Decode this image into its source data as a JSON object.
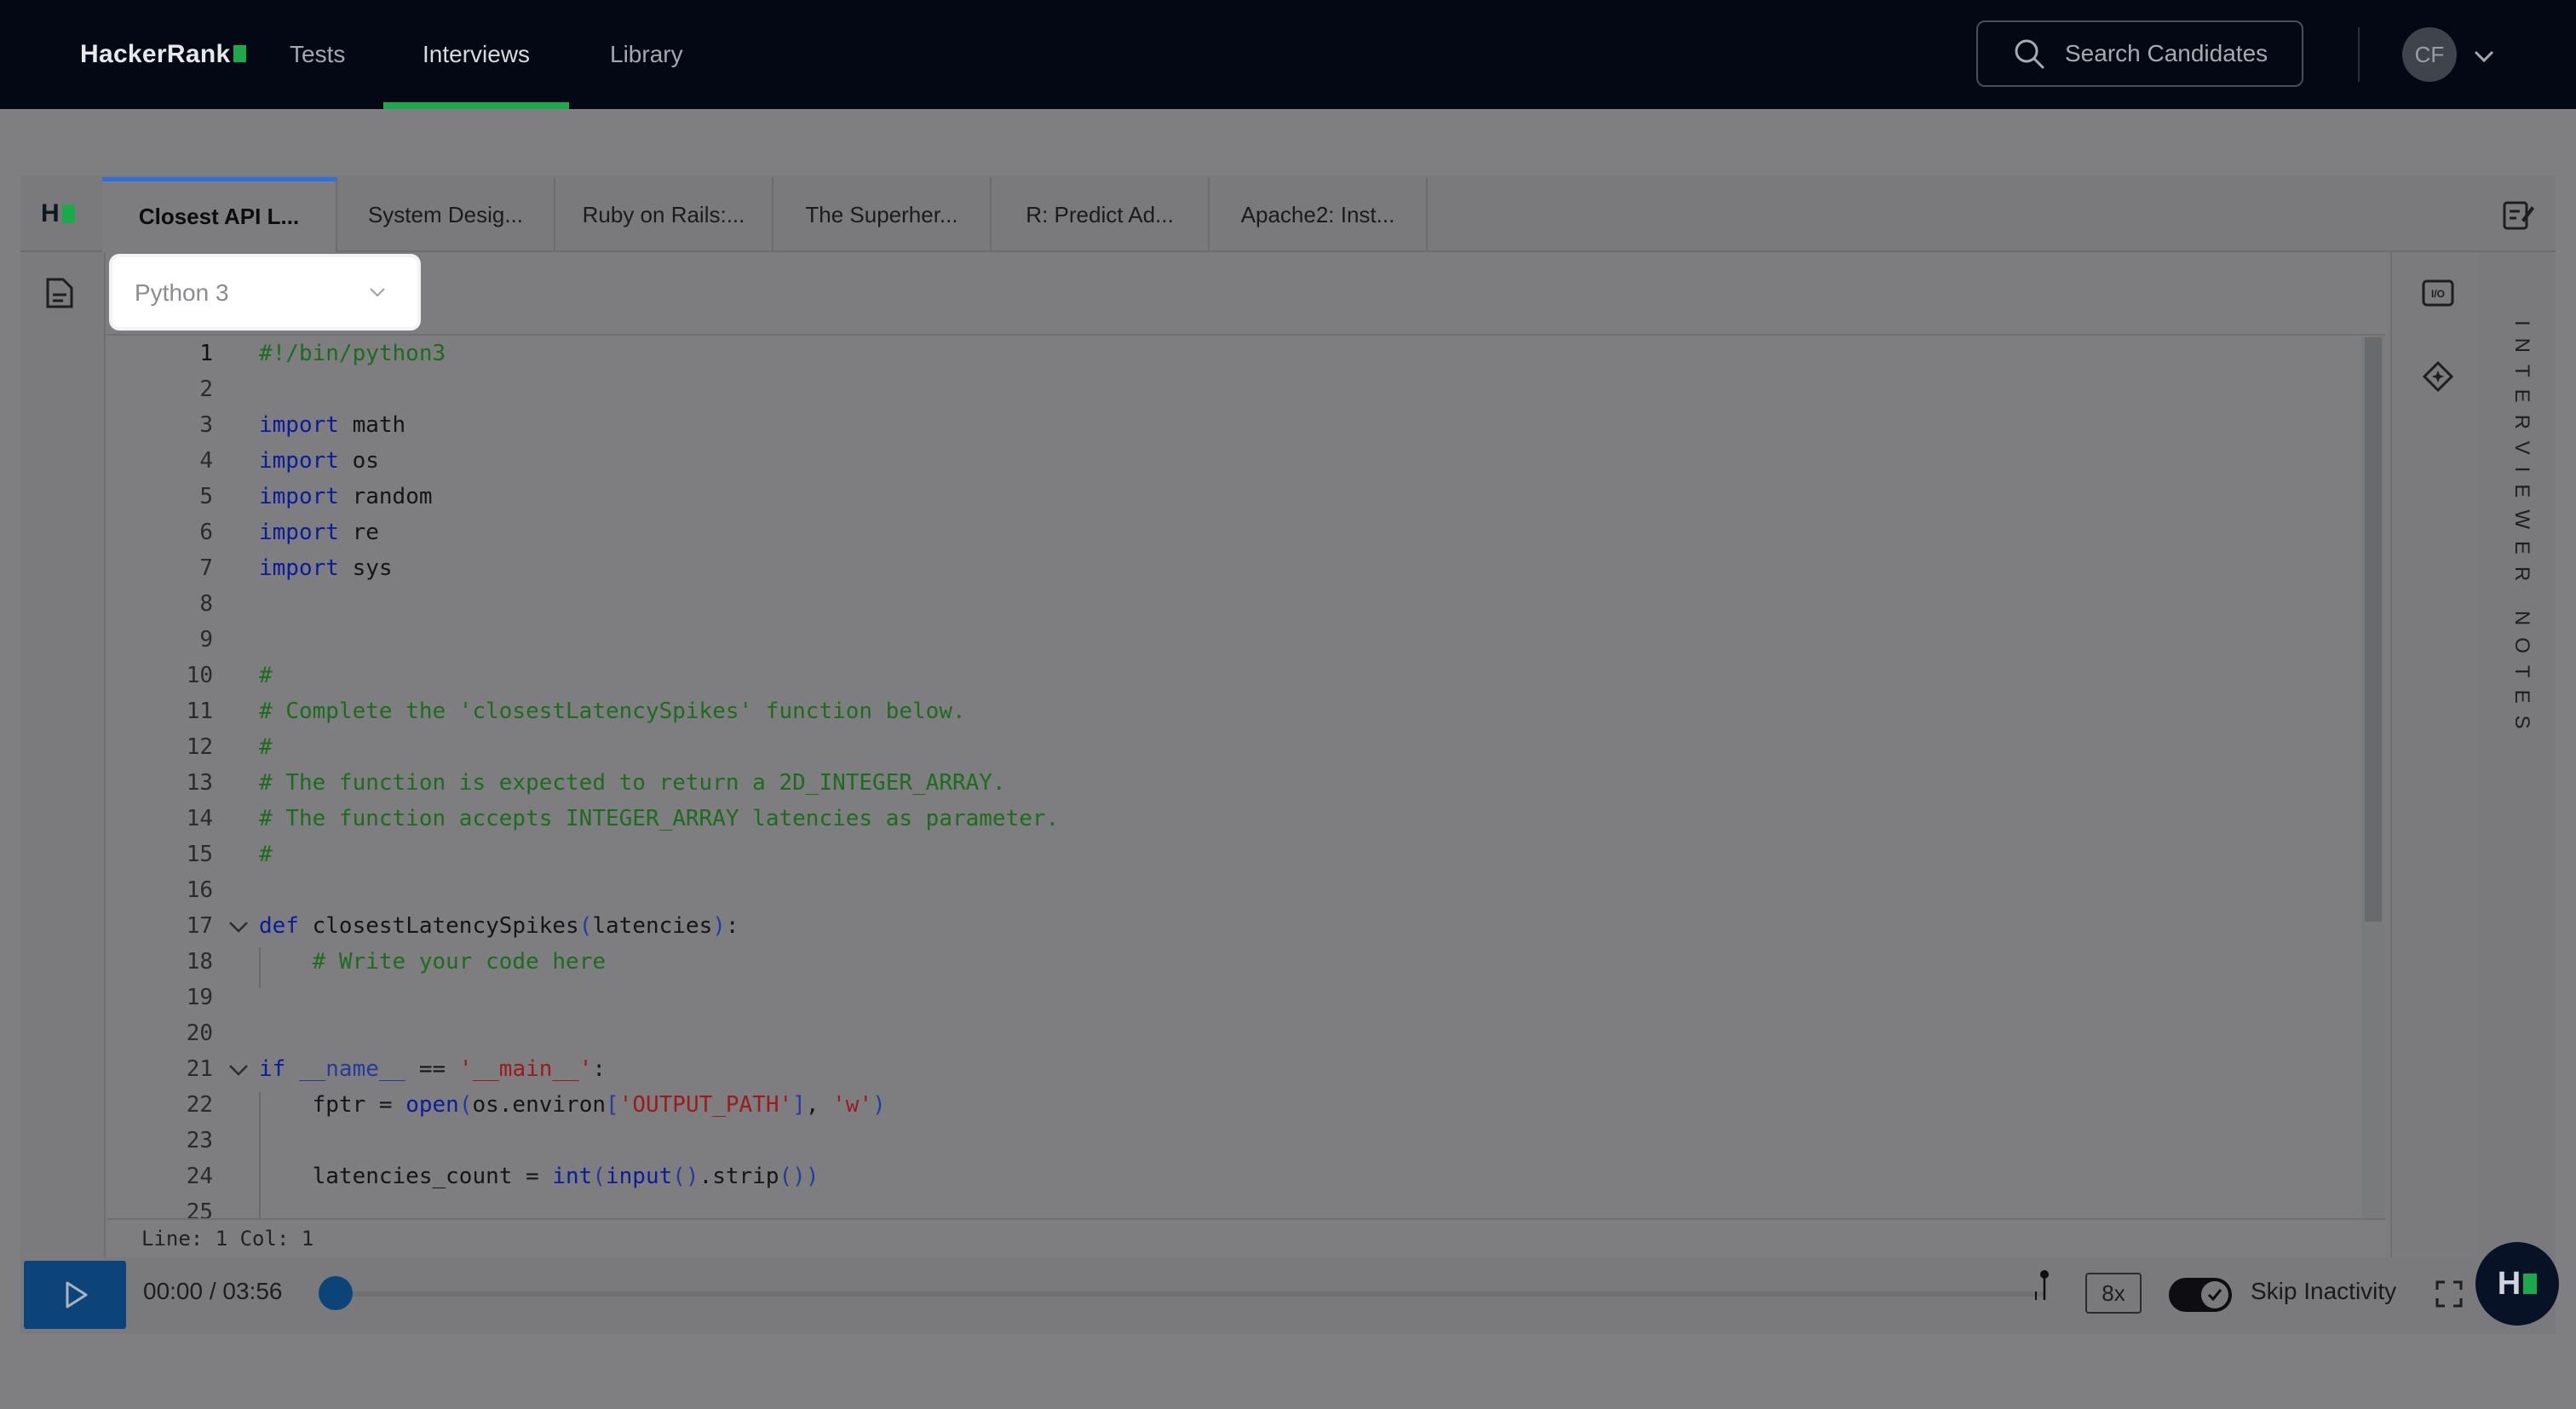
{
  "nav": {
    "logo_text": "HackerRank",
    "links": [
      "Tests",
      "Interviews",
      "Library"
    ],
    "active_link": "Interviews",
    "search_placeholder": "Search Candidates",
    "avatar_initials": "CF"
  },
  "workspace": {
    "logo_text": "H",
    "tabs": [
      {
        "label": "Closest API L..."
      },
      {
        "label": "System Desig..."
      },
      {
        "label": "Ruby on Rails:..."
      },
      {
        "label": "The Superher..."
      },
      {
        "label": "R: Predict Ad..."
      },
      {
        "label": "Apache2: Inst..."
      }
    ],
    "active_tab": 0,
    "language": "Python 3",
    "right_panel_label": "INTERVIEWER NOTES",
    "io_label": "I/O"
  },
  "editor": {
    "line_numbers": [
      "1",
      "2",
      "3",
      "4",
      "5",
      "6",
      "7",
      "8",
      "9",
      "10",
      "11",
      "12",
      "13",
      "14",
      "15",
      "16",
      "17",
      "18",
      "19",
      "20",
      "21",
      "22",
      "23",
      "24",
      "25"
    ],
    "status": "Line: 1 Col: 1"
  },
  "player": {
    "time": "00:00 / 03:56",
    "speed": "8x",
    "skip_label": "Skip Inactivity",
    "skip_enabled": true,
    "progress": 0
  },
  "fab": {
    "logo_text": "H"
  }
}
